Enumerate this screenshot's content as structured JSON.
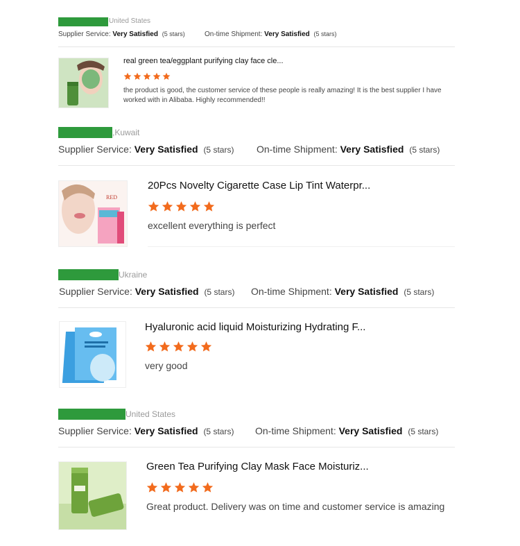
{
  "reviews": [
    {
      "country": "United States",
      "supplier_label": "Supplier Service:",
      "supplier_value": "Very Satisfied",
      "supplier_stars": "(5 stars)",
      "shipment_label": "On-time Shipment:",
      "shipment_value": "Very Satisfied",
      "shipment_stars": "(5 stars)",
      "product_title": "real green tea/eggplant purifying clay face cle...",
      "rating": 5,
      "text": "the product is good, the customer service of these people is really amazing! It is the best supplier I have worked with in Alibaba. Highly recommended!!"
    },
    {
      "country": ",Kuwait",
      "supplier_label": "Supplier Service:",
      "supplier_value": "Very Satisfied",
      "supplier_stars": "(5 stars)",
      "shipment_label": "On-time Shipment:",
      "shipment_value": "Very Satisfied",
      "shipment_stars": "(5 stars)",
      "product_title": "20Pcs Novelty Cigarette Case Lip Tint Waterpr...",
      "rating": 5,
      "text": "excellent everything is perfect",
      "image_label": "RED"
    },
    {
      "country": "Ukraine",
      "supplier_label": "Supplier Service:",
      "supplier_value": "Very Satisfied",
      "supplier_stars": "(5 stars)",
      "shipment_label": "On-time Shipment:",
      "shipment_value": "Very Satisfied",
      "shipment_stars": "(5 stars)",
      "product_title": "Hyaluronic acid liquid Moisturizing Hydrating F...",
      "rating": 5,
      "text": "very good"
    },
    {
      "country": "United States",
      "supplier_label": "Supplier Service:",
      "supplier_value": "Very Satisfied",
      "supplier_stars": "(5 stars)",
      "shipment_label": "On-time Shipment:",
      "shipment_value": "Very Satisfied",
      "shipment_stars": "(5 stars)",
      "product_title": "Green Tea Purifying Clay Mask Face Moisturiz...",
      "rating": 5,
      "text": "Great product. Delivery was on time and customer service is amazing"
    }
  ],
  "colors": {
    "redaction_bar": "#2e9a3c",
    "star": "#f26b1d",
    "divider": "#e6e6e6"
  },
  "icons": {
    "star": "star-icon"
  }
}
